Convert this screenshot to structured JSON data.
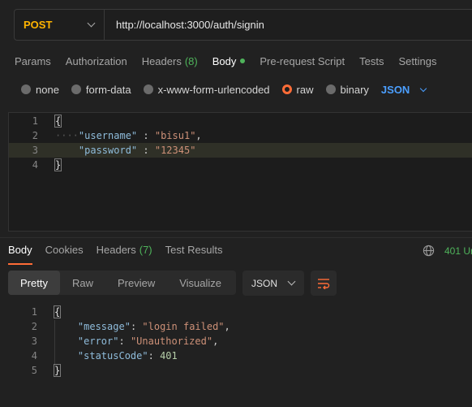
{
  "request": {
    "method": "POST",
    "url": "http://localhost:3000/auth/signin"
  },
  "request_tabs": [
    {
      "label": "Params"
    },
    {
      "label": "Authorization"
    },
    {
      "label": "Headers",
      "count": "(8)"
    },
    {
      "label": "Body",
      "active": true
    },
    {
      "label": "Pre-request Script"
    },
    {
      "label": "Tests"
    },
    {
      "label": "Settings"
    }
  ],
  "body_options": {
    "none": "none",
    "form_data": "form-data",
    "urlencoded": "x-www-form-urlencoded",
    "raw": "raw",
    "binary": "binary",
    "format": "JSON",
    "selected": "raw"
  },
  "request_body": {
    "line_numbers": [
      "1",
      "2",
      "3",
      "4"
    ],
    "open": "{",
    "close": "}",
    "username_key": "\"username\"",
    "username_val": "\"bisu1\"",
    "password_key": "\"password\"",
    "password_val": "\"12345\""
  },
  "response_tabs": {
    "body": "Body",
    "cookies": "Cookies",
    "headers": "Headers",
    "headers_count": "(7)",
    "test_results": "Test Results"
  },
  "status_text": "401 Un",
  "view_modes": {
    "pretty": "Pretty",
    "raw": "Raw",
    "preview": "Preview",
    "visualize": "Visualize"
  },
  "response_format": "JSON",
  "response_body": {
    "line_numbers": [
      "1",
      "2",
      "3",
      "4",
      "5"
    ],
    "open": "{",
    "close": "}",
    "message_key": "\"message\"",
    "message_val": "\"login failed\"",
    "error_key": "\"error\"",
    "error_val": "\"Unauthorized\"",
    "status_key": "\"statusCode\"",
    "status_val": "401"
  },
  "colors": {
    "accent": "#ff6c37",
    "method": "#ffb400",
    "success": "#4fb35b",
    "link": "#4b9fff"
  }
}
